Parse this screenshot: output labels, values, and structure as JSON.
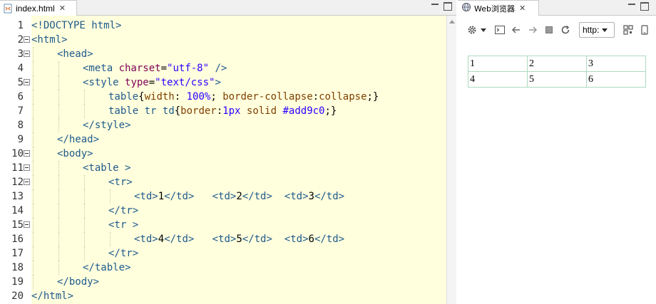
{
  "editor": {
    "tab_label": "index.html",
    "close_glyph": "✕",
    "lines": [
      {
        "n": "1",
        "fold": false,
        "indent": 0,
        "parts": [
          [
            "tag",
            "<!DOCTYPE html>"
          ]
        ]
      },
      {
        "n": "2",
        "fold": true,
        "indent": 0,
        "parts": [
          [
            "tag",
            "<html>"
          ]
        ]
      },
      {
        "n": "3",
        "fold": true,
        "indent": 1,
        "parts": [
          [
            "tag",
            "<head>"
          ]
        ]
      },
      {
        "n": "4",
        "fold": false,
        "indent": 2,
        "parts": [
          [
            "tag",
            "<meta "
          ],
          [
            "attr",
            "charset"
          ],
          [
            "plain",
            "="
          ],
          [
            "val",
            "\"utf-8\""
          ],
          [
            "tag",
            " />"
          ]
        ]
      },
      {
        "n": "5",
        "fold": true,
        "indent": 2,
        "parts": [
          [
            "tag",
            "<style "
          ],
          [
            "attr",
            "type"
          ],
          [
            "plain",
            "="
          ],
          [
            "val",
            "\"text/css\""
          ],
          [
            "tag",
            ">"
          ]
        ]
      },
      {
        "n": "6",
        "fold": false,
        "indent": 3,
        "parts": [
          [
            "tag",
            "table"
          ],
          [
            "plain",
            "{"
          ],
          [
            "cssp",
            "width"
          ],
          [
            "plain",
            ": "
          ],
          [
            "cssv",
            "100%"
          ],
          [
            "plain",
            "; "
          ],
          [
            "cssp",
            "border-collapse"
          ],
          [
            "plain",
            ":"
          ],
          [
            "cssp",
            "collapse"
          ],
          [
            "plain",
            ";}"
          ]
        ]
      },
      {
        "n": "7",
        "fold": false,
        "indent": 3,
        "parts": [
          [
            "tag",
            "table tr td"
          ],
          [
            "plain",
            "{"
          ],
          [
            "cssp",
            "border"
          ],
          [
            "plain",
            ":"
          ],
          [
            "cssv",
            "1px"
          ],
          [
            "cssp",
            " solid "
          ],
          [
            "cssv",
            "#add9c0"
          ],
          [
            "plain",
            ";}"
          ]
        ]
      },
      {
        "n": "8",
        "fold": false,
        "indent": 2,
        "parts": [
          [
            "tag",
            "</style>"
          ]
        ]
      },
      {
        "n": "9",
        "fold": false,
        "indent": 1,
        "parts": [
          [
            "tag",
            "</head>"
          ]
        ]
      },
      {
        "n": "10",
        "fold": true,
        "indent": 1,
        "parts": [
          [
            "tag",
            "<body>"
          ]
        ]
      },
      {
        "n": "11",
        "fold": true,
        "indent": 2,
        "parts": [
          [
            "tag",
            "<table >"
          ]
        ]
      },
      {
        "n": "12",
        "fold": true,
        "indent": 3,
        "parts": [
          [
            "tag",
            "<tr>"
          ]
        ]
      },
      {
        "n": "13",
        "fold": false,
        "indent": 4,
        "parts": [
          [
            "tag",
            "<td>"
          ],
          [
            "plain",
            "1"
          ],
          [
            "tag",
            "</td>"
          ],
          [
            "plain",
            "   "
          ],
          [
            "tag",
            "<td>"
          ],
          [
            "plain",
            "2"
          ],
          [
            "tag",
            "</td>"
          ],
          [
            "plain",
            "  "
          ],
          [
            "tag",
            "<td>"
          ],
          [
            "plain",
            "3"
          ],
          [
            "tag",
            "</td>"
          ]
        ]
      },
      {
        "n": "14",
        "fold": false,
        "indent": 3,
        "parts": [
          [
            "tag",
            "</tr>"
          ]
        ]
      },
      {
        "n": "15",
        "fold": true,
        "indent": 3,
        "parts": [
          [
            "tag",
            "<tr >"
          ]
        ]
      },
      {
        "n": "16",
        "fold": false,
        "indent": 4,
        "parts": [
          [
            "tag",
            "<td>"
          ],
          [
            "plain",
            "4"
          ],
          [
            "tag",
            "</td>"
          ],
          [
            "plain",
            "   "
          ],
          [
            "tag",
            "<td>"
          ],
          [
            "plain",
            "5"
          ],
          [
            "tag",
            "</td>"
          ],
          [
            "plain",
            "  "
          ],
          [
            "tag",
            "<td>"
          ],
          [
            "plain",
            "6"
          ],
          [
            "tag",
            "</td>"
          ]
        ]
      },
      {
        "n": "17",
        "fold": false,
        "indent": 3,
        "parts": [
          [
            "tag",
            "</tr>"
          ]
        ]
      },
      {
        "n": "18",
        "fold": false,
        "indent": 2,
        "parts": [
          [
            "tag",
            "</table>"
          ]
        ]
      },
      {
        "n": "19",
        "fold": false,
        "indent": 1,
        "parts": [
          [
            "tag",
            "</body>"
          ]
        ]
      },
      {
        "n": "20",
        "fold": false,
        "indent": 0,
        "parts": [
          [
            "tag",
            "</html>"
          ]
        ]
      }
    ]
  },
  "browser": {
    "tab_label": "Web浏览器",
    "close_glyph": "✕",
    "url_scheme": "http:",
    "table": [
      [
        "1",
        "2",
        "3"
      ],
      [
        "4",
        "5",
        "6"
      ]
    ],
    "table_border_color": "#add9c0"
  },
  "colors": {
    "editor_bg": "#ffffdd",
    "tag": "#205a8c",
    "attr": "#7f0055",
    "value": "#2a00ff"
  },
  "icons": [
    "html-file-icon",
    "globe-icon",
    "gear-icon",
    "console-icon",
    "back-arrow-icon",
    "forward-arrow-icon",
    "stop-icon",
    "refresh-icon",
    "qr-code-icon",
    "device-icon",
    "minimize-icon",
    "maximize-icon"
  ]
}
